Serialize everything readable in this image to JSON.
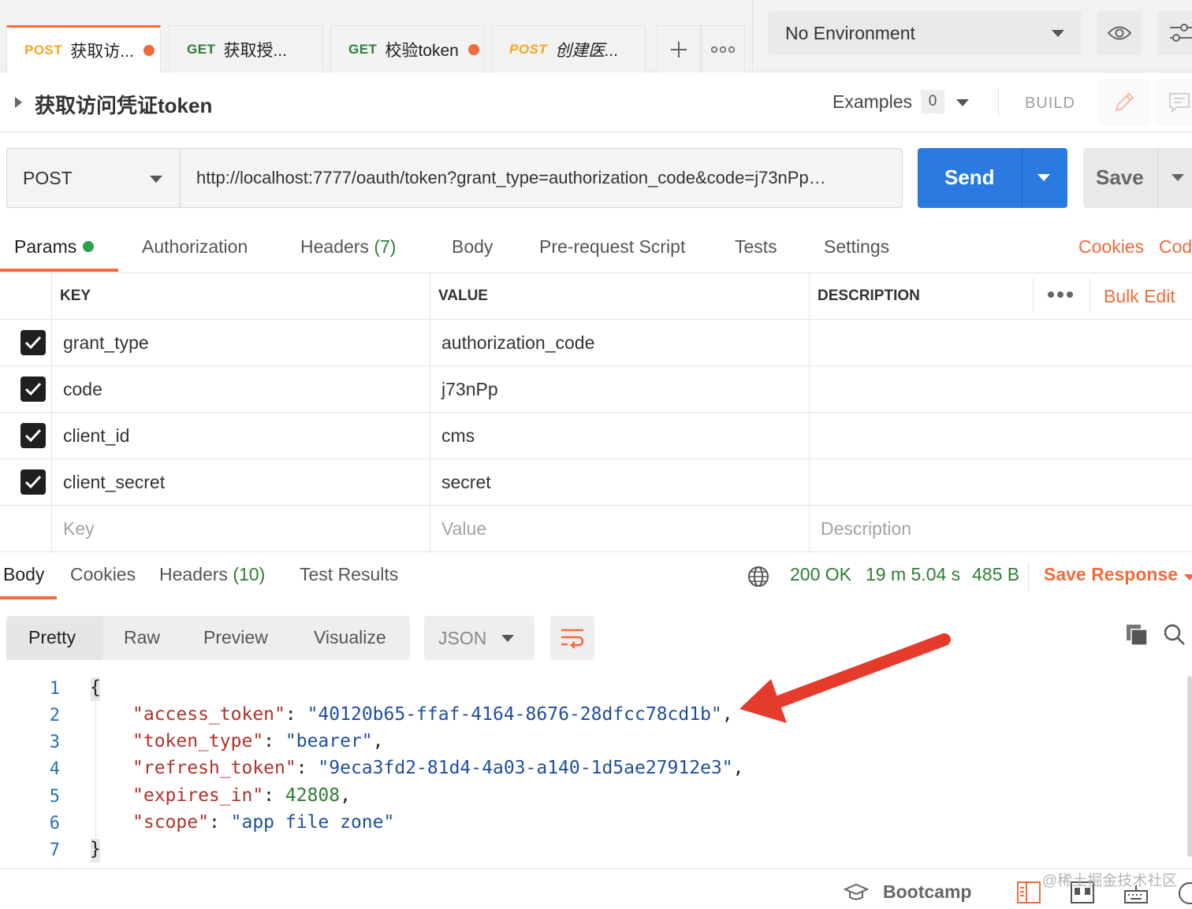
{
  "tabs": [
    {
      "method": "POST",
      "label": "获取访...",
      "dot": true,
      "italic": false,
      "active": true
    },
    {
      "method": "GET",
      "label": "获取授...",
      "dot": false,
      "italic": false,
      "active": false
    },
    {
      "method": "GET",
      "label": "校验token",
      "dot": true,
      "italic": false,
      "active": false
    },
    {
      "method": "POST",
      "label": "创建医...",
      "dot": false,
      "italic": true,
      "active": false
    }
  ],
  "tabbar": {
    "add_icon": "plus-icon",
    "more_icon": "more-horizontal-icon"
  },
  "environment": {
    "selected": "No Environment",
    "eye_icon": "eye-icon",
    "settings_icon": "sliders-icon"
  },
  "request": {
    "name": "获取访问凭证token",
    "examples_label": "Examples",
    "examples_count": "0",
    "build_label": "BUILD",
    "method": "POST",
    "url": "http://localhost:7777/oauth/token?grant_type=authorization_code&code=j73nPp…",
    "send_label": "Send",
    "save_label": "Save"
  },
  "request_tabs": {
    "params": "Params",
    "authorization": "Authorization",
    "headers": "Headers",
    "headers_count": "(7)",
    "body": "Body",
    "prerequest": "Pre-request Script",
    "tests": "Tests",
    "settings": "Settings",
    "cookies": "Cookies",
    "code": "Cod"
  },
  "params_table": {
    "headers": {
      "key": "KEY",
      "value": "VALUE",
      "description": "DESCRIPTION",
      "bulk_edit": "Bulk Edit"
    },
    "rows": [
      {
        "key": "grant_type",
        "value": "authorization_code",
        "checked": true
      },
      {
        "key": "code",
        "value": "j73nPp",
        "checked": true
      },
      {
        "key": "client_id",
        "value": "cms",
        "checked": true
      },
      {
        "key": "client_secret",
        "value": "secret",
        "checked": true
      }
    ],
    "placeholders": {
      "key": "Key",
      "value": "Value",
      "description": "Description"
    }
  },
  "response": {
    "tabs": {
      "body": "Body",
      "cookies": "Cookies",
      "headers": "Headers",
      "headers_count": "(10)",
      "test_results": "Test Results"
    },
    "status": "200 OK",
    "time": "19 m 5.04 s",
    "size": "485 B",
    "save_response": "Save Response",
    "view_modes": [
      "Pretty",
      "Raw",
      "Preview",
      "Visualize"
    ],
    "format": "JSON",
    "line_numbers": [
      "1",
      "2",
      "3",
      "4",
      "5",
      "6",
      "7"
    ],
    "json": {
      "open": "{",
      "close": "}",
      "access_token_key": "\"access_token\"",
      "access_token_val": "\"40120b65-ffaf-4164-8676-28dfcc78cd1b\"",
      "token_type_key": "\"token_type\"",
      "token_type_val": "\"bearer\"",
      "refresh_token_key": "\"refresh_token\"",
      "refresh_token_val": "\"9eca3fd2-81d4-4a03-a140-1d5ae27912e3\"",
      "expires_in_key": "\"expires_in\"",
      "expires_in_val": "42808",
      "scope_key": "\"scope\"",
      "scope_val": "\"app file zone\""
    }
  },
  "footer": {
    "bootcamp": "Bootcamp",
    "watermark": "@稀土掘金技术社区"
  },
  "colors": {
    "accent": "#f26b3a",
    "send_blue": "#2a7ae2",
    "status_green": "#2e7d32",
    "arrow_red": "#e53b2c"
  }
}
